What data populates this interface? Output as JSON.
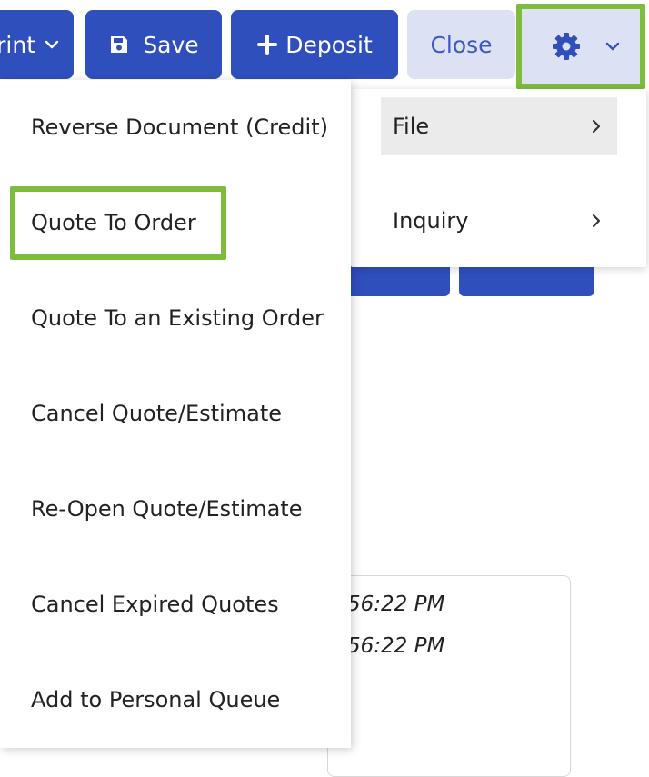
{
  "toolbar": {
    "print_label": "rint",
    "save_label": "Save",
    "deposit_label": "Deposit",
    "close_label": "Close"
  },
  "settings_menu": {
    "items": [
      {
        "label": "File"
      },
      {
        "label": "Inquiry"
      }
    ]
  },
  "actions_menu": {
    "items": [
      {
        "label": "Reverse Document (Credit)"
      },
      {
        "label": "Quote To Order"
      },
      {
        "label": "Quote To an Existing Order"
      },
      {
        "label": "Cancel Quote/Estimate"
      },
      {
        "label": "Re-Open Quote/Estimate"
      },
      {
        "label": "Cancel Expired Quotes"
      },
      {
        "label": "Add to Personal Queue"
      }
    ]
  },
  "background": {
    "time_1": "56:22 PM",
    "time_2": "56:22 PM"
  },
  "colors": {
    "primary": "#2f4fbd",
    "secondary_bg": "#dde1f4",
    "highlight": "#7cbd3e"
  },
  "icons": {
    "save": "floppy-disk-icon",
    "deposit": "plus-icon",
    "settings": "gear-icon",
    "dropdown": "chevron-down-icon",
    "submenu": "chevron-right-icon"
  }
}
